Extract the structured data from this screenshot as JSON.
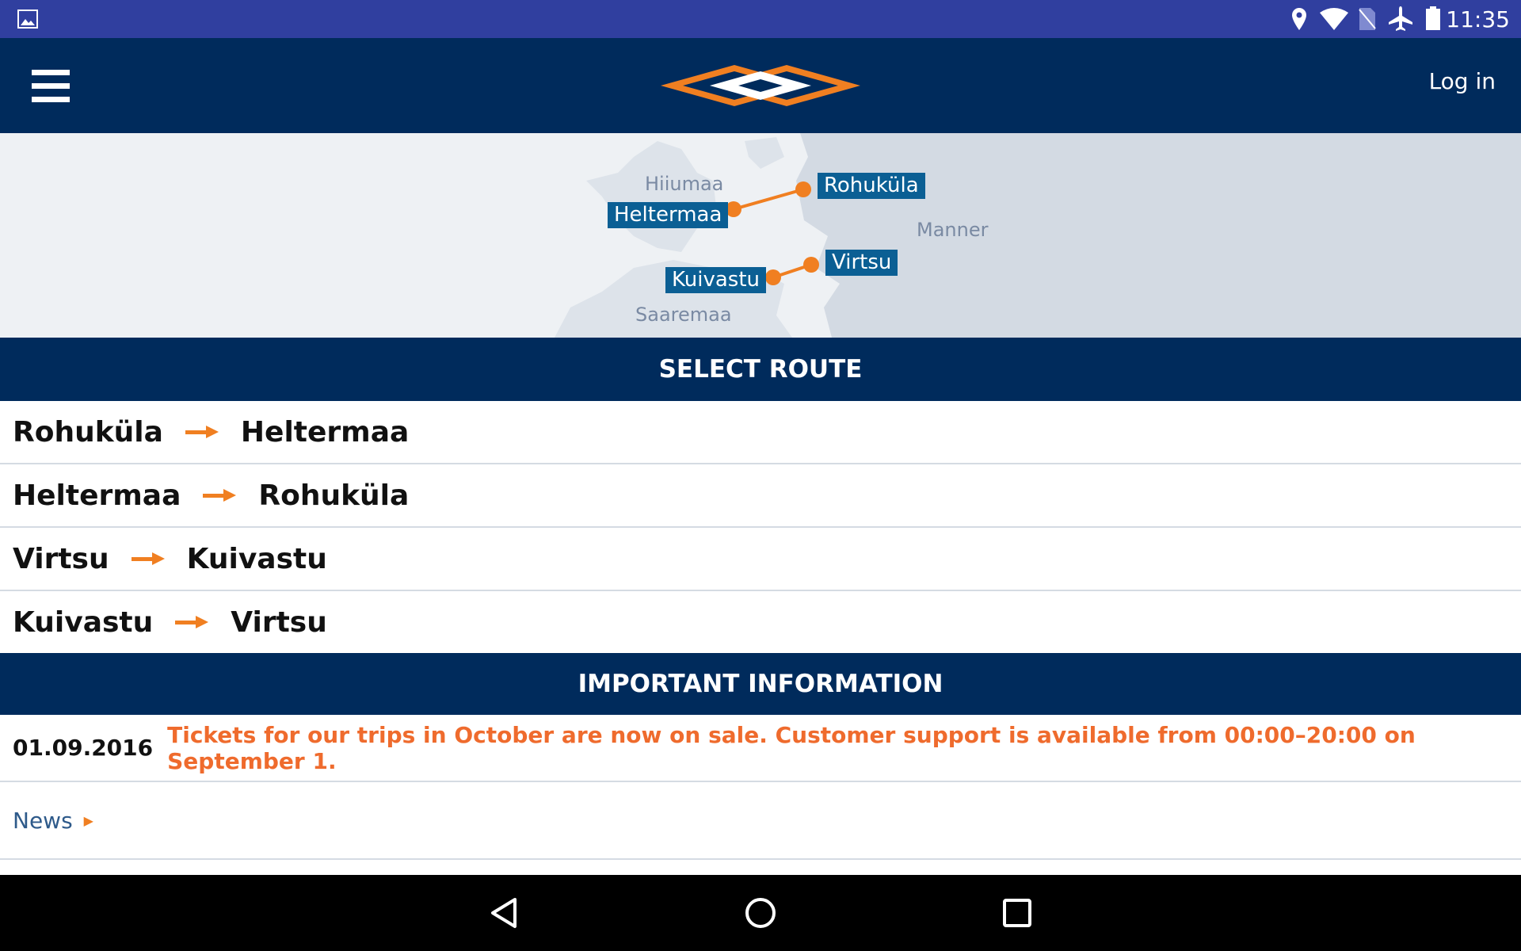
{
  "status_bar": {
    "time": "11:35",
    "icons": [
      "image-icon",
      "location-icon",
      "wifi-icon",
      "no-sim-icon",
      "airplane-icon",
      "battery-icon"
    ]
  },
  "header": {
    "menu_icon": "hamburger-icon",
    "logo": "ferry-logo",
    "login_label": "Log in"
  },
  "map": {
    "islands": [
      "Hiiumaa",
      "Saaremaa",
      "Manner"
    ],
    "ports": [
      "Rohuküla",
      "Heltermaa",
      "Virtsu",
      "Kuivastu"
    ],
    "accent": "#f07f21",
    "label_color": "#0b5f94"
  },
  "select_route": {
    "title": "SELECT ROUTE",
    "routes": [
      {
        "from": "Rohuküla",
        "to": "Heltermaa"
      },
      {
        "from": "Heltermaa",
        "to": "Rohuküla"
      },
      {
        "from": "Virtsu",
        "to": "Kuivastu"
      },
      {
        "from": "Kuivastu",
        "to": "Virtsu"
      }
    ]
  },
  "important": {
    "title": "IMPORTANT INFORMATION",
    "date": "01.09.2016",
    "message": "Tickets for our trips in October are now on sale. Customer support is available from 00:00–20:00 on September 1."
  },
  "news": {
    "label": "News"
  },
  "colors": {
    "navy": "#002b5c",
    "status": "#303f9f",
    "orange": "#f07f21",
    "message": "#ef6b2d"
  }
}
